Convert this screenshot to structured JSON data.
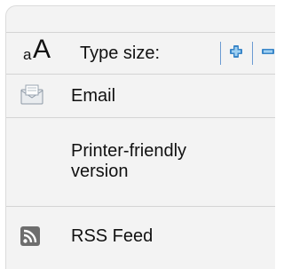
{
  "type_size": {
    "label": "Type size:",
    "small_a": "a",
    "big_a": "A",
    "increase_icon": "plus-icon",
    "decrease_icon": "minus-icon"
  },
  "email": {
    "label": "Email",
    "icon": "envelope-icon"
  },
  "printer": {
    "label_line1": "Printer-friendly",
    "label_line2": "version"
  },
  "rss": {
    "label": "RSS Feed",
    "icon": "rss-icon"
  },
  "colors": {
    "accent": "#3a86c8",
    "panel_bg": "#f3f3f3",
    "divider": "#d4d4d4"
  }
}
